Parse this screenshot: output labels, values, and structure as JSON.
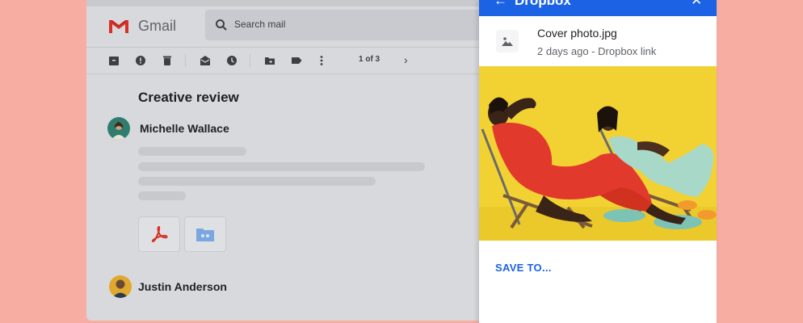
{
  "gmail": {
    "app_name": "Gmail",
    "search": {
      "placeholder": "Search mail"
    },
    "toolbar": {
      "icons": [
        "archive-icon",
        "report-spam-icon",
        "delete-icon",
        "mark-unread-icon",
        "snooze-icon",
        "move-to-icon",
        "label-icon",
        "more-vert-icon"
      ],
      "page_count": "1 of 3",
      "next_icon": "chevron-right-icon"
    },
    "thread": {
      "subject": "Creative review",
      "messages": [
        {
          "sender": "Michelle Wallace",
          "avatar_color": "#2e7d6e"
        },
        {
          "sender": "Justin Anderson",
          "avatar_color": "#e0a82e"
        }
      ],
      "attachments": [
        {
          "type": "pdf",
          "icon": "pdf-icon",
          "color": "#d93025"
        },
        {
          "type": "folder",
          "icon": "shared-folder-icon",
          "color": "#7aa7e0"
        }
      ]
    }
  },
  "dropbox": {
    "title": "Dropbox",
    "back_icon": "arrow-back-icon",
    "close_icon": "close-icon",
    "file": {
      "name": "Cover photo.jpg",
      "meta": "2 days ago - Dropbox link",
      "icon": "image-icon"
    },
    "save_to_label": "SAVE TO...",
    "accent_color": "#1b62e5"
  }
}
